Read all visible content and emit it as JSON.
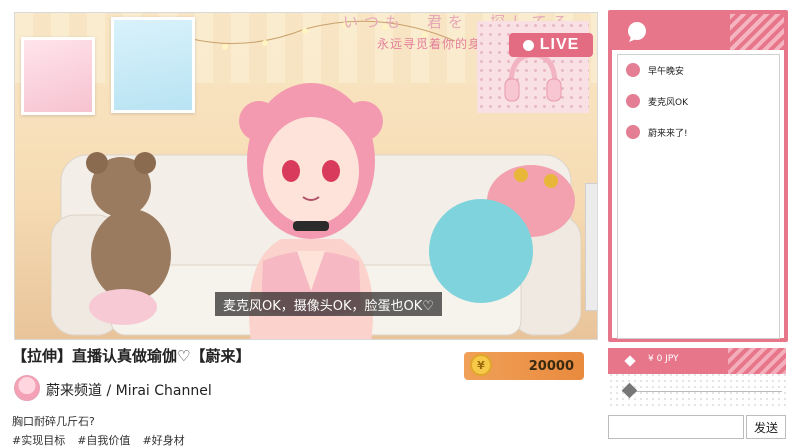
{
  "stream": {
    "overlay_jp": "いつも　君を　探してる",
    "overlay_cn": "永远寻觅着你的身影",
    "live_label": "LIVE",
    "subtitle": "麦克风OK，摄像头OK，脸蛋也OK♡"
  },
  "info": {
    "title": "【拉伸】直播认真做瑜伽♡【蔚来】",
    "channel_name": "蔚来频道 / Mirai Channel",
    "description": "胸口耐碎几斤石?",
    "tags": [
      "#实现目标",
      "#自我价值",
      "#好身材"
    ]
  },
  "coins": {
    "symbol": "¥",
    "amount": "20000"
  },
  "chat": {
    "messages": [
      {
        "text": "早午晚安"
      },
      {
        "text": "麦克风OK"
      },
      {
        "text": "蔚来来了!"
      }
    ]
  },
  "donation": {
    "amount_label": "¥ 0 JPY",
    "slider_value": 0
  },
  "input": {
    "value": "",
    "send_label": "发送"
  },
  "colors": {
    "accent": "#e7768b",
    "coin_banner": "#e98a3e"
  }
}
